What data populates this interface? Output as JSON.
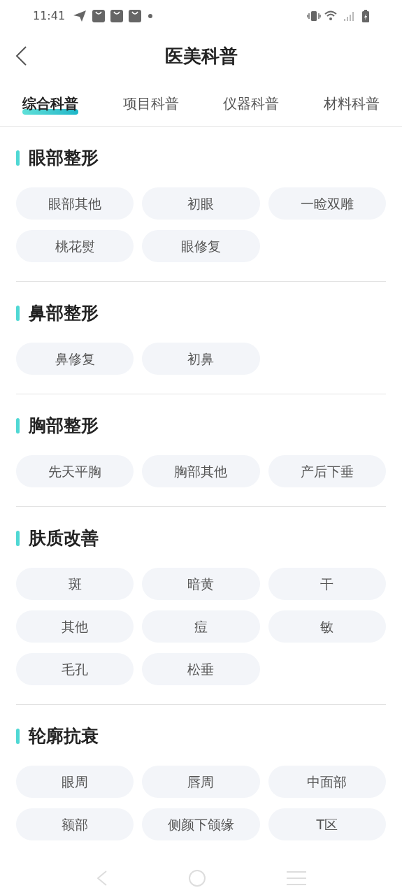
{
  "status_bar": {
    "time": "11:41"
  },
  "header": {
    "title": "医美科普"
  },
  "tabs": [
    {
      "label": "综合科普",
      "selected": true
    },
    {
      "label": "项目科普",
      "selected": false
    },
    {
      "label": "仪器科普",
      "selected": false
    },
    {
      "label": "材料科普",
      "selected": false
    }
  ],
  "sections": [
    {
      "title": "眼部整形",
      "tags": [
        "眼部其他",
        "初眼",
        "一睑双雕",
        "桃花熨",
        "眼修复"
      ]
    },
    {
      "title": "鼻部整形",
      "tags": [
        "鼻修复",
        "初鼻"
      ]
    },
    {
      "title": "胸部整形",
      "tags": [
        "先天平胸",
        "胸部其他",
        "产后下垂"
      ]
    },
    {
      "title": "肤质改善",
      "tags": [
        "斑",
        "暗黄",
        "干",
        "其他",
        "痘",
        "敏",
        "毛孔",
        "松垂"
      ]
    },
    {
      "title": "轮廓抗衰",
      "tags": [
        "眼周",
        "唇周",
        "中面部",
        "额部",
        "侧颜下颌缘",
        "T区"
      ]
    }
  ]
}
